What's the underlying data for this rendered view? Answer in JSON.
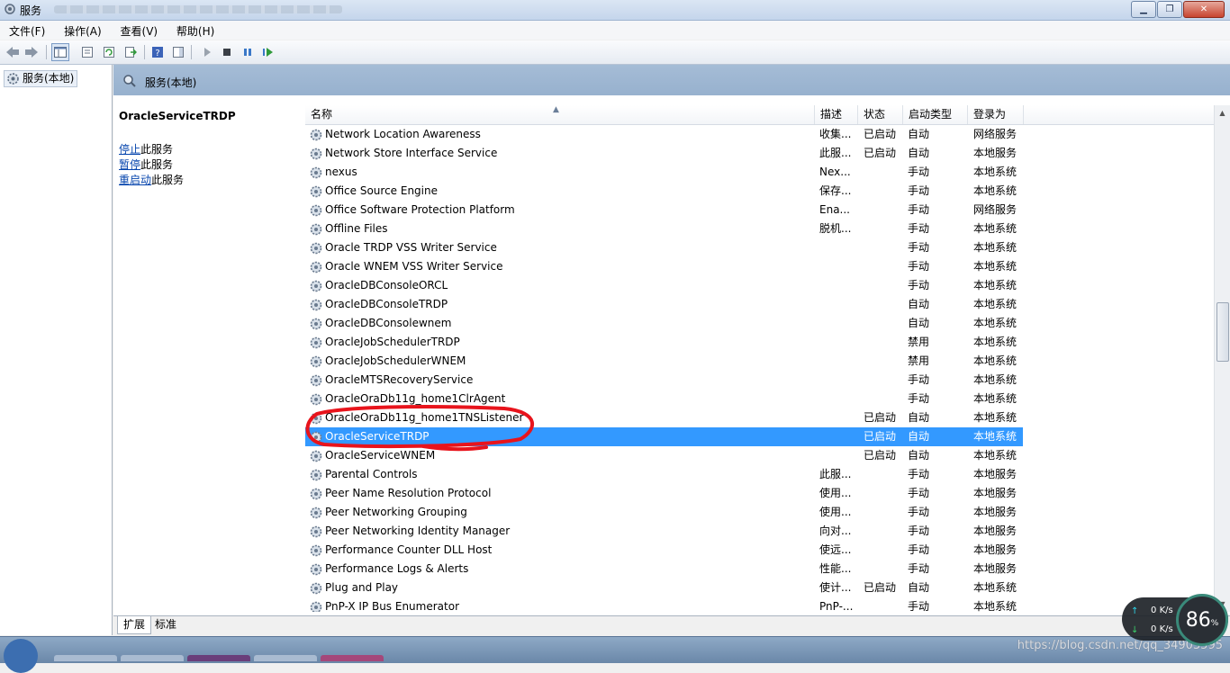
{
  "window": {
    "title": "服务"
  },
  "menu": [
    "文件(F)",
    "操作(A)",
    "查看(V)",
    "帮助(H)"
  ],
  "tree": {
    "root_label": "服务(本地)"
  },
  "pane": {
    "title": "服务(本地)",
    "selected_service": "OracleServiceTRDP",
    "actions": [
      {
        "link": "停止",
        "text": "此服务"
      },
      {
        "link": "暂停",
        "text": "此服务"
      },
      {
        "link": "重启动",
        "text": "此服务"
      }
    ]
  },
  "columns": {
    "name": "名称",
    "desc": "描述",
    "status": "状态",
    "startup": "启动类型",
    "logon": "登录为"
  },
  "services": [
    {
      "name": "Network Location Awareness",
      "desc": "收集...",
      "status": "已启动",
      "startup": "自动",
      "logon": "网络服务"
    },
    {
      "name": "Network Store Interface Service",
      "desc": "此服...",
      "status": "已启动",
      "startup": "自动",
      "logon": "本地服务"
    },
    {
      "name": "nexus",
      "desc": "Nex...",
      "status": "",
      "startup": "手动",
      "logon": "本地系统"
    },
    {
      "name": "Office  Source Engine",
      "desc": "保存...",
      "status": "",
      "startup": "手动",
      "logon": "本地系统"
    },
    {
      "name": "Office Software Protection Platform",
      "desc": "Ena...",
      "status": "",
      "startup": "手动",
      "logon": "网络服务"
    },
    {
      "name": "Offline Files",
      "desc": "脱机...",
      "status": "",
      "startup": "手动",
      "logon": "本地系统"
    },
    {
      "name": "Oracle TRDP VSS Writer Service",
      "desc": "",
      "status": "",
      "startup": "手动",
      "logon": "本地系统"
    },
    {
      "name": "Oracle WNEM VSS Writer Service",
      "desc": "",
      "status": "",
      "startup": "手动",
      "logon": "本地系统"
    },
    {
      "name": "OracleDBConsoleORCL",
      "desc": "",
      "status": "",
      "startup": "手动",
      "logon": "本地系统"
    },
    {
      "name": "OracleDBConsoleTRDP",
      "desc": "",
      "status": "",
      "startup": "自动",
      "logon": "本地系统"
    },
    {
      "name": "OracleDBConsolewnem",
      "desc": "",
      "status": "",
      "startup": "自动",
      "logon": "本地系统"
    },
    {
      "name": "OracleJobSchedulerTRDP",
      "desc": "",
      "status": "",
      "startup": "禁用",
      "logon": "本地系统"
    },
    {
      "name": "OracleJobSchedulerWNEM",
      "desc": "",
      "status": "",
      "startup": "禁用",
      "logon": "本地系统"
    },
    {
      "name": "OracleMTSRecoveryService",
      "desc": "",
      "status": "",
      "startup": "手动",
      "logon": "本地系统"
    },
    {
      "name": "OracleOraDb11g_home1ClrAgent",
      "desc": "",
      "status": "",
      "startup": "手动",
      "logon": "本地系统"
    },
    {
      "name": "OracleOraDb11g_home1TNSListener",
      "desc": "",
      "status": "已启动",
      "startup": "自动",
      "logon": "本地系统"
    },
    {
      "name": "OracleServiceTRDP",
      "desc": "",
      "status": "已启动",
      "startup": "自动",
      "logon": "本地系统",
      "selected": true
    },
    {
      "name": "OracleServiceWNEM",
      "desc": "",
      "status": "已启动",
      "startup": "自动",
      "logon": "本地系统"
    },
    {
      "name": "Parental Controls",
      "desc": "此服...",
      "status": "",
      "startup": "手动",
      "logon": "本地服务"
    },
    {
      "name": "Peer Name Resolution Protocol",
      "desc": "使用...",
      "status": "",
      "startup": "手动",
      "logon": "本地服务"
    },
    {
      "name": "Peer Networking Grouping",
      "desc": "使用...",
      "status": "",
      "startup": "手动",
      "logon": "本地服务"
    },
    {
      "name": "Peer Networking Identity Manager",
      "desc": "向对...",
      "status": "",
      "startup": "手动",
      "logon": "本地服务"
    },
    {
      "name": "Performance Counter DLL Host",
      "desc": "使远...",
      "status": "",
      "startup": "手动",
      "logon": "本地服务"
    },
    {
      "name": "Performance Logs & Alerts",
      "desc": "性能...",
      "status": "",
      "startup": "手动",
      "logon": "本地服务"
    },
    {
      "name": "Plug and Play",
      "desc": "使计...",
      "status": "已启动",
      "startup": "自动",
      "logon": "本地系统"
    },
    {
      "name": "PnP-X IP Bus Enumerator",
      "desc": "PnP-...",
      "status": "",
      "startup": "手动",
      "logon": "本地系统"
    }
  ],
  "tabs": [
    "扩展",
    "标准"
  ],
  "network_widget": {
    "up": "0",
    "down": "0",
    "unit": "K/s",
    "gauge": "86",
    "gauge_unit": "%"
  },
  "watermark": "https://blog.csdn.net/qq_34903595",
  "colors": {
    "selection": "#3399ff",
    "annotation": "#e8141c",
    "header": "#97b1ce"
  }
}
